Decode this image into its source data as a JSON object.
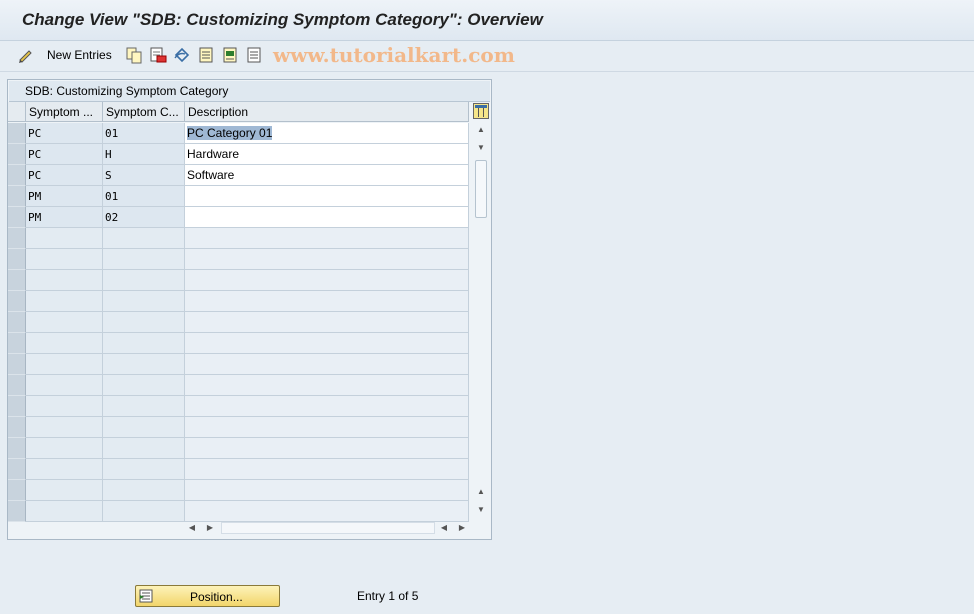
{
  "title": "Change View \"SDB: Customizing Symptom Category\": Overview",
  "toolbar": {
    "new_entries_label": "New Entries",
    "watermark": "www.tutorialkart.com"
  },
  "panel": {
    "title": "SDB: Customizing Symptom Category"
  },
  "table": {
    "columns": [
      "Symptom ...",
      "Symptom C...",
      "Description"
    ],
    "rows": [
      [
        "PC",
        "01",
        "PC Category 01"
      ],
      [
        "PC",
        "H",
        "Hardware"
      ],
      [
        "PC",
        "S",
        "Software"
      ],
      [
        "PM",
        "01",
        ""
      ],
      [
        "PM",
        "02",
        ""
      ]
    ],
    "selected_cell": "PC Category 01"
  },
  "footer": {
    "position_label": "Position...",
    "entry_text": "Entry 1 of 5"
  },
  "colors": {
    "button_yellow": "#f2d56b",
    "watermark": "#f2b88a",
    "highlight": "#9fb8d4"
  }
}
